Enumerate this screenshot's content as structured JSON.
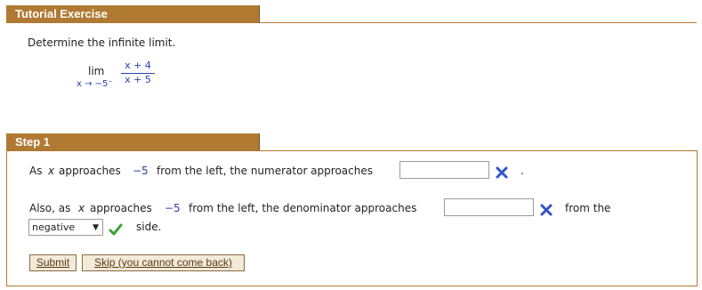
{
  "tutorial": {
    "title": "Tutorial Exercise",
    "prompt": "Determine the infinite limit.",
    "limit": {
      "lim_word": "lim",
      "subscript": "x → −5⁻",
      "numerator": "x + 4",
      "denominator": "x + 5"
    }
  },
  "step1": {
    "title": "Step 1",
    "line1": {
      "as": "As",
      "var": "x",
      "approaches": "approaches",
      "value": "−5",
      "rest": "from the left, the numerator approaches",
      "answer_value": "",
      "end": "."
    },
    "line2": {
      "also": "Also, as",
      "var": "x",
      "approaches": "approaches",
      "value": "−5",
      "rest": "from the left, the denominator approaches",
      "answer_value": "",
      "from_the": "from the"
    },
    "side_select": {
      "selected": "negative",
      "arrow": "▼"
    },
    "side_word": "side.",
    "status_colors": {
      "incorrect": "#2f54c8",
      "correct": "#3aa33a"
    },
    "buttons": {
      "submit": "Submit",
      "skip": "Skip (you cannot come back)"
    }
  }
}
